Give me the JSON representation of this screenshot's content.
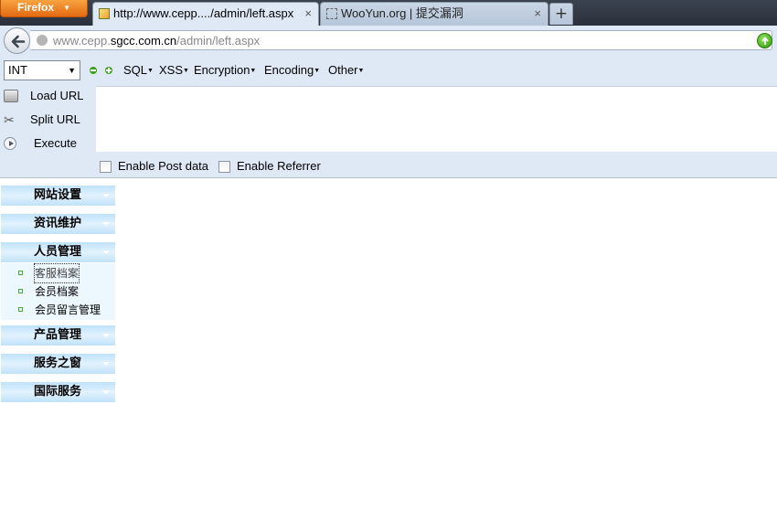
{
  "browser": {
    "app_button": "Firefox",
    "tabs": [
      {
        "title": "http://www.cepp..../admin/left.aspx",
        "close": "×"
      },
      {
        "title": "WooYun.org | 提交漏洞",
        "close": "×"
      }
    ],
    "new_tab": "+",
    "url": {
      "prefix": "www.cepp.",
      "host": "sgcc.com.cn",
      "path": "/admin/left.aspx"
    }
  },
  "hackbar": {
    "select_value": "INT",
    "menus": [
      "SQL",
      "XSS",
      "Encryption",
      "Encoding",
      "Other"
    ],
    "actions": [
      {
        "label": "Load URL",
        "icon": "load-url-icon"
      },
      {
        "label": "Split URL",
        "icon": "scissors-icon"
      },
      {
        "label": "Execute",
        "icon": "play-icon"
      }
    ],
    "checkboxes": [
      "Enable Post data",
      "Enable Referrer"
    ]
  },
  "admin_menu": {
    "groups": [
      "网站设置",
      "资讯维护",
      "人员管理",
      "产品管理",
      "服务之窗",
      "国际服务"
    ],
    "expanded_group_items": [
      "客服档案",
      "会员档案",
      "会员留言管理"
    ]
  },
  "colors": {
    "accent_orange": "#e46a12",
    "menu_blue": "#bfe2fb",
    "bullet_green": "#4aa83a"
  }
}
